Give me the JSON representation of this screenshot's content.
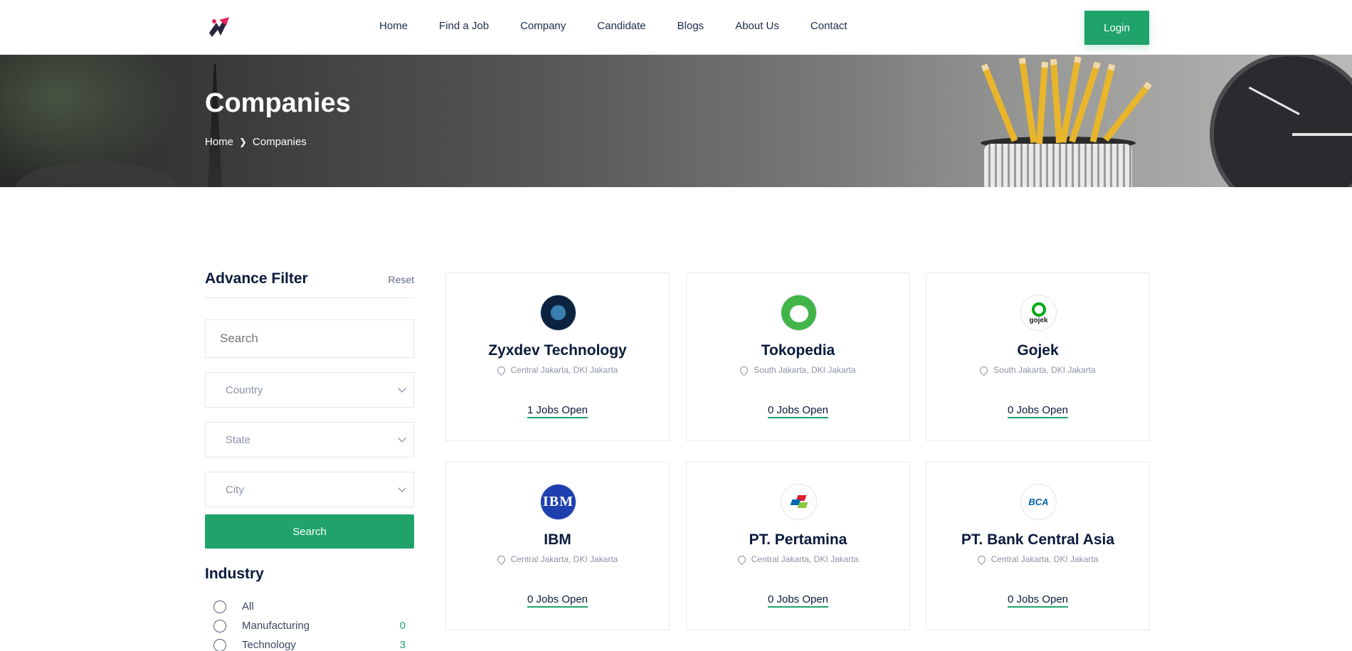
{
  "nav": {
    "items": [
      "Home",
      "Find a Job",
      "Company",
      "Candidate",
      "Blogs",
      "About Us",
      "Contact"
    ],
    "login": "Login"
  },
  "banner": {
    "title": "Companies",
    "breadcrumb": [
      "Home",
      "Companies"
    ]
  },
  "filter": {
    "title": "Advance Filter",
    "reset": "Reset",
    "search_placeholder": "Search",
    "country": "Country",
    "state": "State",
    "city": "City",
    "search_button": "Search",
    "industry_title": "Industry",
    "industries": [
      {
        "label": "All",
        "count": ""
      },
      {
        "label": "Manufacturing",
        "count": "0"
      },
      {
        "label": "Technology",
        "count": "3"
      }
    ]
  },
  "companies": [
    {
      "name": "Zyxdev Technology",
      "location": "Central Jakarta, DKI Jakarta",
      "jobs": "1 Jobs Open",
      "logo": "zyxdev-logo"
    },
    {
      "name": "Tokopedia",
      "location": "South Jakarta, DKI Jakarta",
      "jobs": "0 Jobs Open",
      "logo": "tokopedia-logo"
    },
    {
      "name": "Gojek",
      "location": "South Jakarta, DKI Jakarta",
      "jobs": "0 Jobs Open",
      "logo": "gojek-logo",
      "logo_text": "gojek"
    },
    {
      "name": "IBM",
      "location": "Central Jakarta, DKI Jakarta",
      "jobs": "0 Jobs Open",
      "logo": "ibm-logo",
      "logo_text": "IBM"
    },
    {
      "name": "PT. Pertamina",
      "location": "Central Jakarta, DKI Jakarta",
      "jobs": "0 Jobs Open",
      "logo": "pertamina-logo"
    },
    {
      "name": "PT. Bank Central Asia",
      "location": "Central Jakarta, DKI Jakarta",
      "jobs": "0 Jobs Open",
      "logo": "bca-logo",
      "logo_text": "BCA"
    }
  ],
  "colors": {
    "accent": "#1fa36b",
    "heading": "#0a1a3c"
  }
}
